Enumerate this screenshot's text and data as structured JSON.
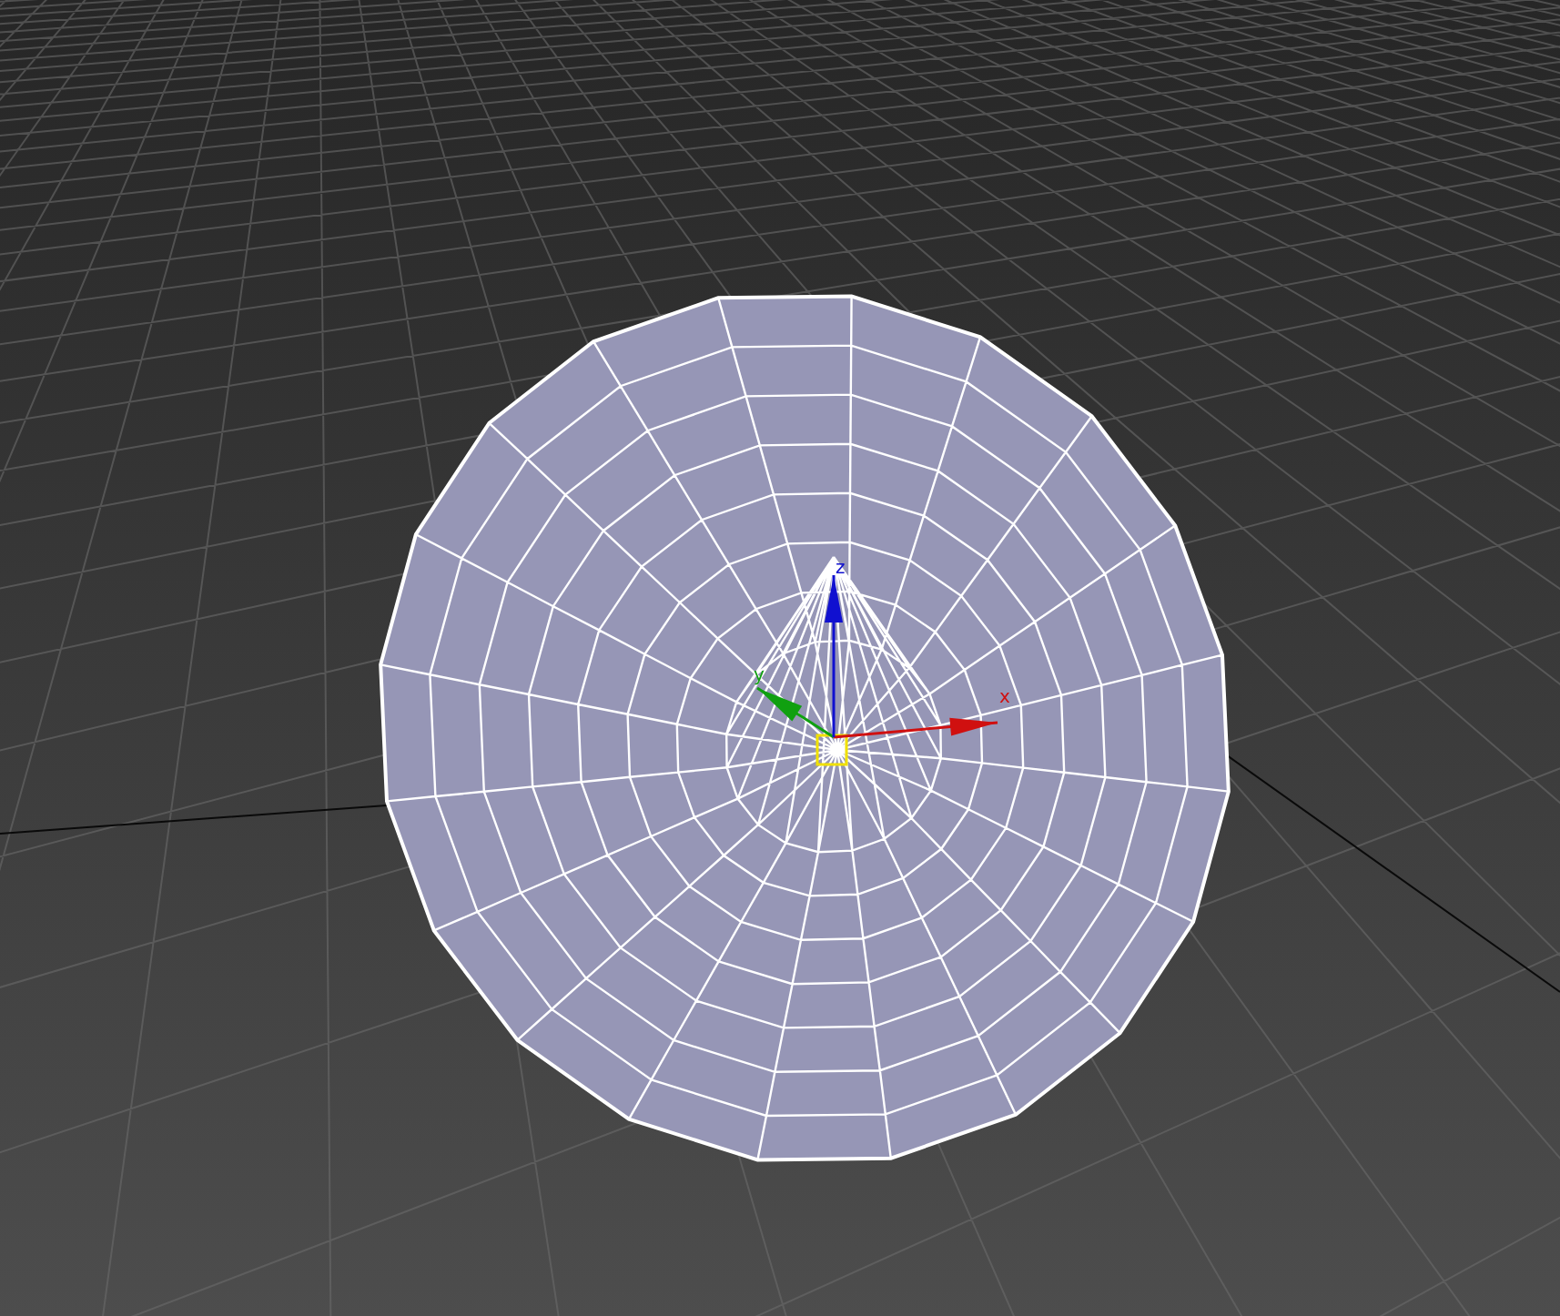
{
  "viewport": {
    "gizmo": {
      "axes": [
        {
          "label": "x",
          "color": "#d01010"
        },
        {
          "label": "y",
          "color": "#10a010"
        },
        {
          "label": "z",
          "color": "#1010d0"
        }
      ]
    }
  }
}
